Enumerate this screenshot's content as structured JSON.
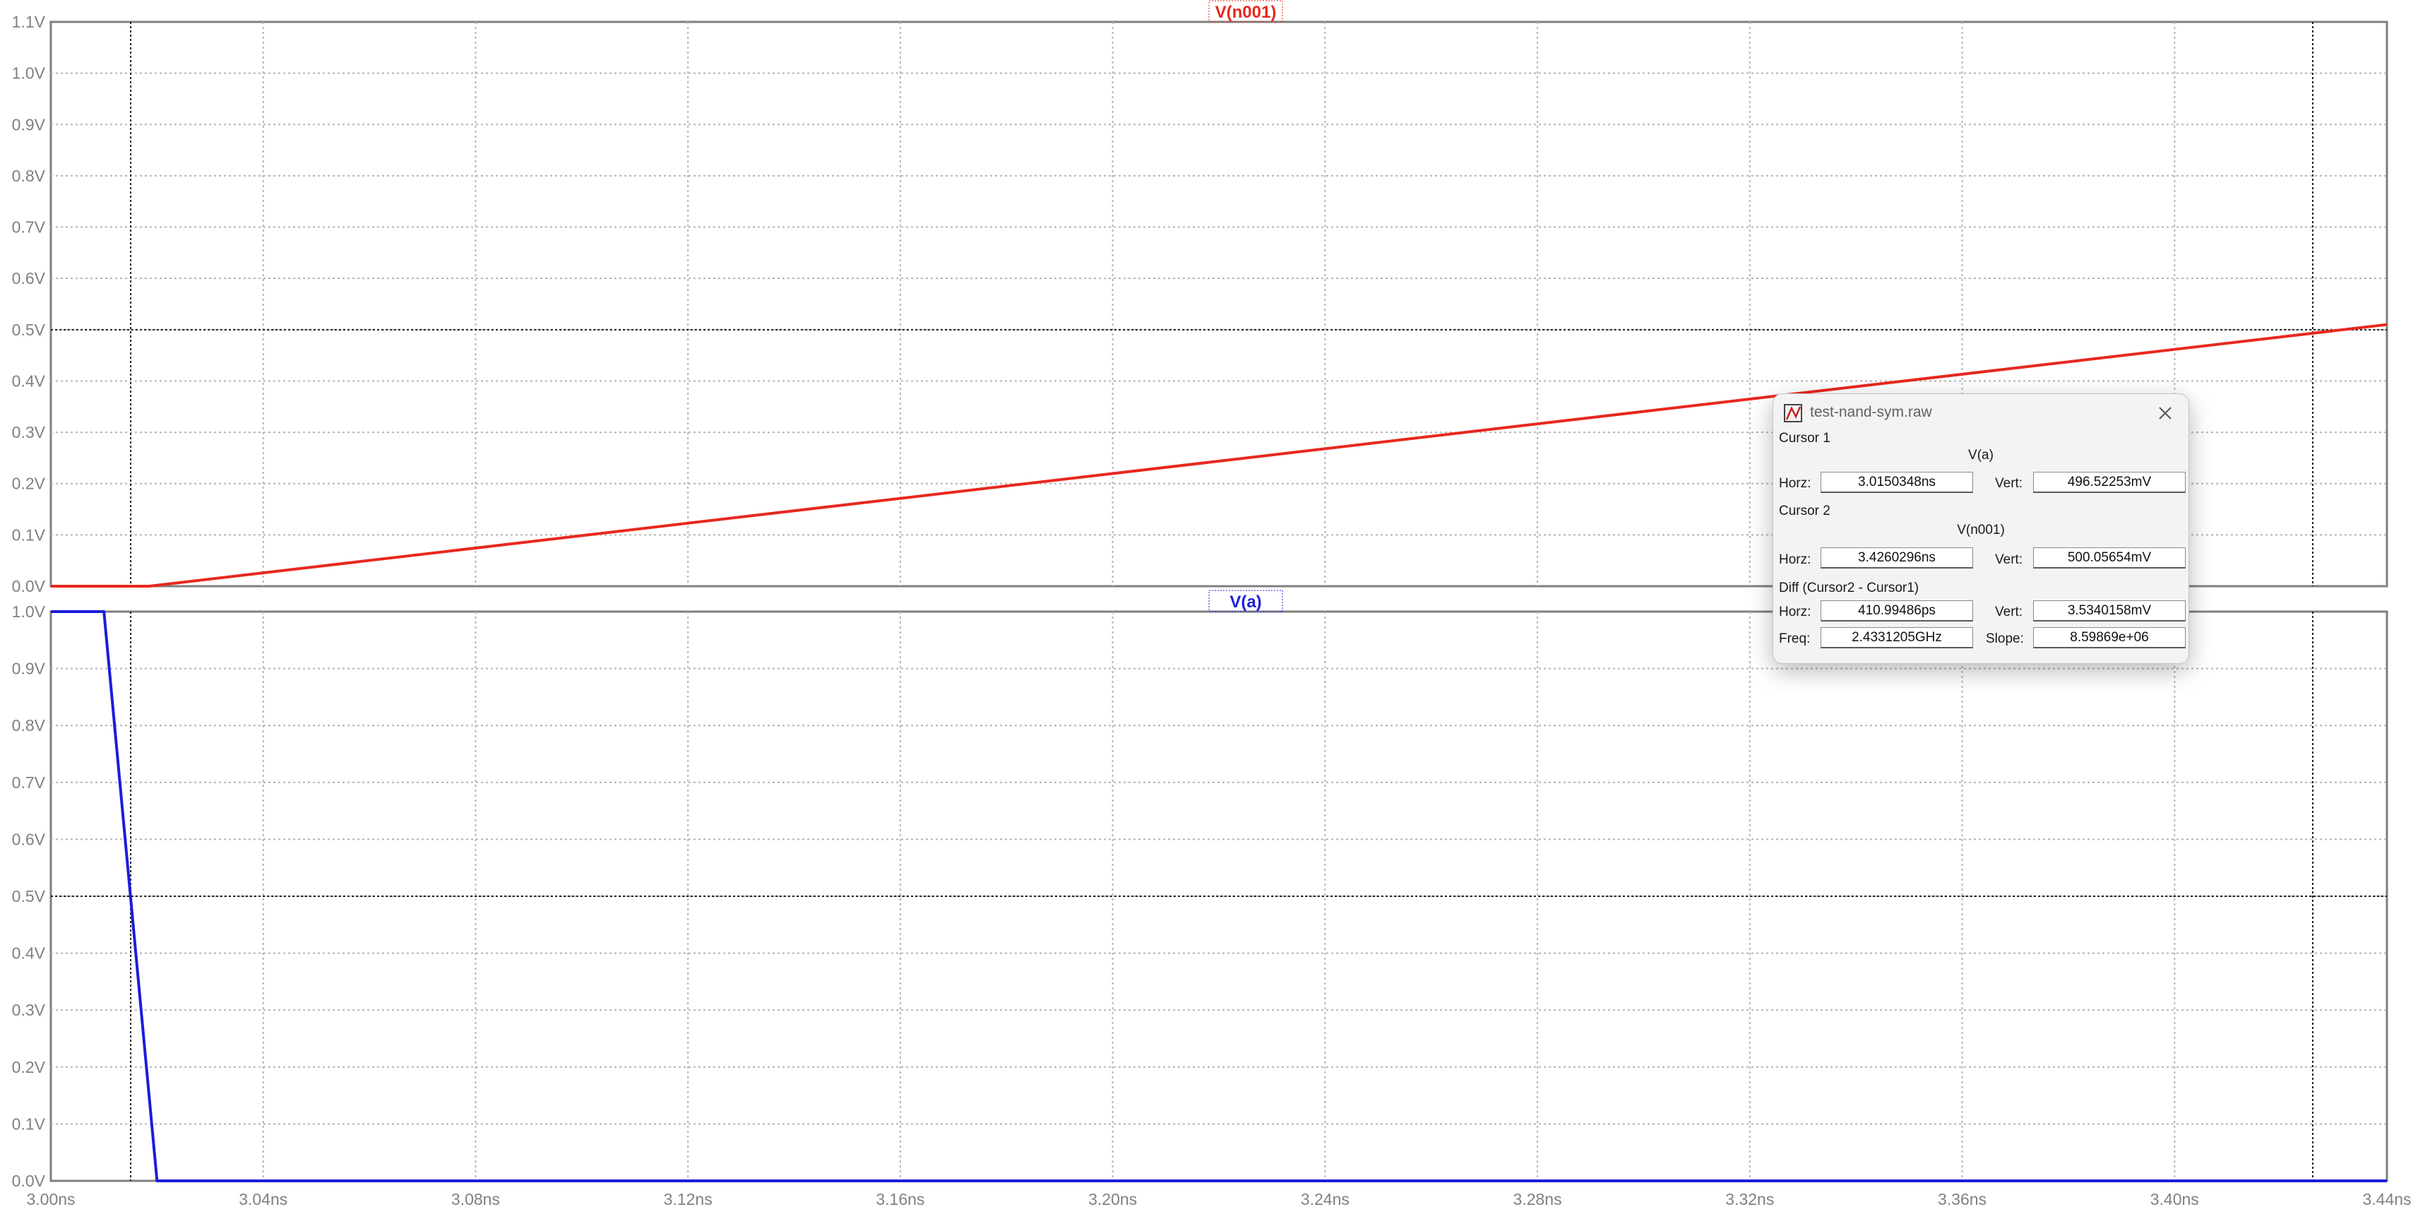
{
  "chart_data": [
    {
      "type": "line",
      "title": "V(n001)",
      "x_tick_labels": [],
      "y_tick_labels": [
        "0.0V",
        "0.1V",
        "0.2V",
        "0.3V",
        "0.4V",
        "0.5V",
        "0.6V",
        "0.7V",
        "0.8V",
        "0.9V",
        "1.0V",
        "1.1V"
      ],
      "xlim": [
        3.0,
        3.44
      ],
      "ylim": [
        0.0,
        1.1
      ],
      "x_unit": "ns",
      "grid": true,
      "series": [
        {
          "name": "V(n001)",
          "color": "#e8281e",
          "x": [
            3.0,
            3.0185,
            3.44
          ],
          "y": [
            0.0,
            0.0,
            0.51
          ]
        }
      ]
    },
    {
      "type": "line",
      "title": "V(a)",
      "x_tick_labels": [
        "3.00ns",
        "3.04ns",
        "3.08ns",
        "3.12ns",
        "3.16ns",
        "3.20ns",
        "3.24ns",
        "3.28ns",
        "3.32ns",
        "3.36ns",
        "3.40ns",
        "3.44ns"
      ],
      "y_tick_labels": [
        "0.0V",
        "0.1V",
        "0.2V",
        "0.3V",
        "0.4V",
        "0.5V",
        "0.6V",
        "0.7V",
        "0.8V",
        "0.9V",
        "1.0V"
      ],
      "xlim": [
        3.0,
        3.44
      ],
      "ylim": [
        0.0,
        1.0
      ],
      "x_unit": "ns",
      "grid": true,
      "series": [
        {
          "name": "V(a)",
          "color": "#1c1cdc",
          "x": [
            3.0,
            3.01,
            3.02,
            3.44
          ],
          "y": [
            1.0,
            1.0,
            0.0,
            0.0
          ]
        }
      ]
    }
  ],
  "cursors": {
    "cursor1_x_ns": 3.0150348,
    "cursor2_x_ns": 3.4260296,
    "cursor1_level_v": 0.5,
    "cursor2_level_v": 0.5
  },
  "dialog": {
    "title": "test-nand-sym.raw",
    "app_icon": "ltspice-waveform-icon",
    "close_icon": "close-icon",
    "cursor1": {
      "heading": "Cursor 1",
      "trace": "V(a)",
      "horz_label": "Horz:",
      "horz": "3.0150348ns",
      "vert_label": "Vert:",
      "vert": "496.52253mV"
    },
    "cursor2": {
      "heading": "Cursor 2",
      "trace": "V(n001)",
      "horz_label": "Horz:",
      "horz": "3.4260296ns",
      "vert_label": "Vert:",
      "vert": "500.05654mV"
    },
    "diff": {
      "heading": "Diff (Cursor2 - Cursor1)",
      "horz_label": "Horz:",
      "horz": "410.99486ps",
      "vert_label": "Vert:",
      "vert": "3.5340158mV",
      "freq_label": "Freq:",
      "freq": "2.4331205GHz",
      "slope_label": "Slope:",
      "slope": "8.59869e+06"
    }
  },
  "colors": {
    "grid": "#b4b4b4",
    "frame": "#7f7f7f",
    "tick_text": "#808080",
    "cursor": "#202020"
  }
}
